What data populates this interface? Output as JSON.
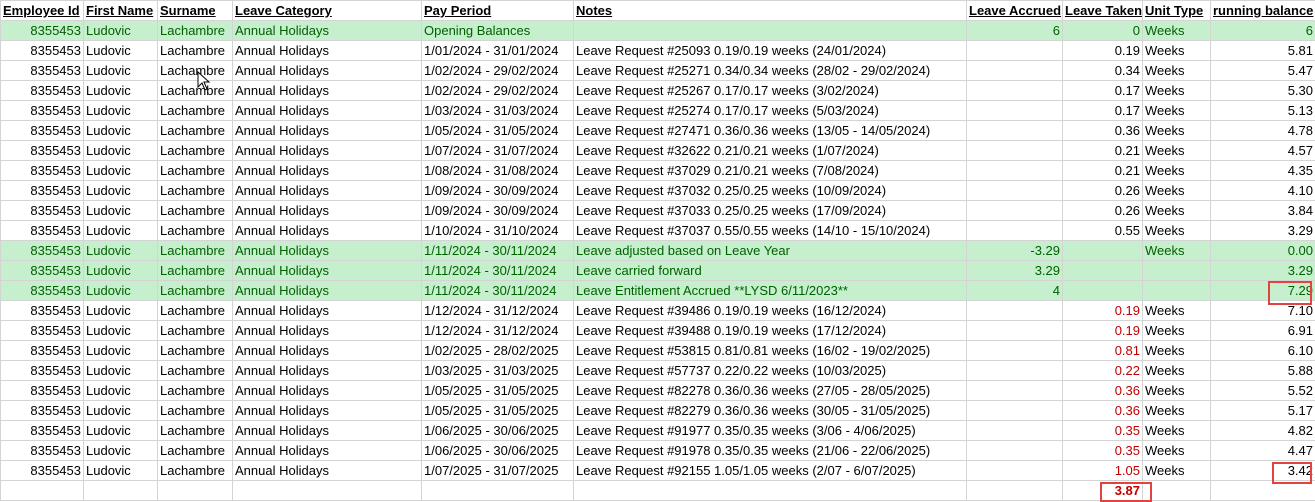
{
  "columns": [
    "Employee Id",
    "First Name",
    "Surname",
    "Leave Category",
    "Pay Period",
    "Notes",
    "Leave Accrued",
    "Leave Taken",
    "Unit Type",
    "running balance"
  ],
  "rows": [
    {
      "hl": true,
      "id": "8355453",
      "first": "Ludovic",
      "surname": "Lachambre",
      "category": "Annual Holidays",
      "period": "Opening Balances",
      "notes": "",
      "accrued": "6",
      "taken": "0",
      "unit": "Weeks",
      "balance": "6"
    },
    {
      "hl": false,
      "id": "8355453",
      "first": "Ludovic",
      "surname": "Lachambre",
      "category": "Annual Holidays",
      "period": "1/01/2024 - 31/01/2024",
      "notes": "Leave Request #25093 0.19/0.19 weeks (24/01/2024)",
      "accrued": "",
      "taken": "0.19",
      "unit": "Weeks",
      "balance": "5.81"
    },
    {
      "hl": false,
      "id": "8355453",
      "first": "Ludovic",
      "surname": "Lachambre",
      "category": "Annual Holidays",
      "period": "1/02/2024 - 29/02/2024",
      "notes": "Leave Request #25271 0.34/0.34 weeks (28/02 - 29/02/2024)",
      "accrued": "",
      "taken": "0.34",
      "unit": "Weeks",
      "balance": "5.47"
    },
    {
      "hl": false,
      "id": "8355453",
      "first": "Ludovic",
      "surname": "Lachambre",
      "category": "Annual Holidays",
      "period": "1/02/2024 - 29/02/2024",
      "notes": "Leave Request #25267 0.17/0.17 weeks (3/02/2024)",
      "accrued": "",
      "taken": "0.17",
      "unit": "Weeks",
      "balance": "5.30"
    },
    {
      "hl": false,
      "id": "8355453",
      "first": "Ludovic",
      "surname": "Lachambre",
      "category": "Annual Holidays",
      "period": "1/03/2024 - 31/03/2024",
      "notes": "Leave Request #25274 0.17/0.17 weeks (5/03/2024)",
      "accrued": "",
      "taken": "0.17",
      "unit": "Weeks",
      "balance": "5.13"
    },
    {
      "hl": false,
      "id": "8355453",
      "first": "Ludovic",
      "surname": "Lachambre",
      "category": "Annual Holidays",
      "period": "1/05/2024 - 31/05/2024",
      "notes": "Leave Request #27471 0.36/0.36 weeks (13/05 - 14/05/2024)",
      "accrued": "",
      "taken": "0.36",
      "unit": "Weeks",
      "balance": "4.78"
    },
    {
      "hl": false,
      "id": "8355453",
      "first": "Ludovic",
      "surname": "Lachambre",
      "category": "Annual Holidays",
      "period": "1/07/2024 - 31/07/2024",
      "notes": "Leave Request #32622 0.21/0.21 weeks (1/07/2024)",
      "accrued": "",
      "taken": "0.21",
      "unit": "Weeks",
      "balance": "4.57"
    },
    {
      "hl": false,
      "id": "8355453",
      "first": "Ludovic",
      "surname": "Lachambre",
      "category": "Annual Holidays",
      "period": "1/08/2024 - 31/08/2024",
      "notes": "Leave Request #37029 0.21/0.21 weeks (7/08/2024)",
      "accrued": "",
      "taken": "0.21",
      "unit": "Weeks",
      "balance": "4.35"
    },
    {
      "hl": false,
      "id": "8355453",
      "first": "Ludovic",
      "surname": "Lachambre",
      "category": "Annual Holidays",
      "period": "1/09/2024 - 30/09/2024",
      "notes": "Leave Request #37032 0.25/0.25 weeks (10/09/2024)",
      "accrued": "",
      "taken": "0.26",
      "unit": "Weeks",
      "balance": "4.10"
    },
    {
      "hl": false,
      "id": "8355453",
      "first": "Ludovic",
      "surname": "Lachambre",
      "category": "Annual Holidays",
      "period": "1/09/2024 - 30/09/2024",
      "notes": "Leave Request #37033 0.25/0.25 weeks (17/09/2024)",
      "accrued": "",
      "taken": "0.26",
      "unit": "Weeks",
      "balance": "3.84"
    },
    {
      "hl": false,
      "id": "8355453",
      "first": "Ludovic",
      "surname": "Lachambre",
      "category": "Annual Holidays",
      "period": "1/10/2024 - 31/10/2024",
      "notes": "Leave Request #37037 0.55/0.55 weeks (14/10 - 15/10/2024)",
      "accrued": "",
      "taken": "0.55",
      "unit": "Weeks",
      "balance": "3.29"
    },
    {
      "hl": true,
      "id": "8355453",
      "first": "Ludovic",
      "surname": "Lachambre",
      "category": "Annual Holidays",
      "period": "1/11/2024 - 30/11/2024",
      "notes": "Leave adjusted based on Leave Year",
      "accrued": "-3.29",
      "taken": "",
      "unit": "Weeks",
      "balance": "0.00"
    },
    {
      "hl": true,
      "id": "8355453",
      "first": "Ludovic",
      "surname": "Lachambre",
      "category": "Annual Holidays",
      "period": "1/11/2024 - 30/11/2024",
      "notes": "Leave carried forward",
      "accrued": "3.29",
      "taken": "",
      "unit": "",
      "balance": "3.29"
    },
    {
      "hl": true,
      "id": "8355453",
      "first": "Ludovic",
      "surname": "Lachambre",
      "category": "Annual Holidays",
      "period": "1/11/2024 - 30/11/2024",
      "notes": "Leave Entitlement Accrued **LYSD 6/11/2023**",
      "accrued": "4",
      "taken": "",
      "unit": "",
      "balance": "7.29"
    },
    {
      "hl": false,
      "id": "8355453",
      "first": "Ludovic",
      "surname": "Lachambre",
      "category": "Annual Holidays",
      "period": "1/12/2024 - 31/12/2024",
      "notes": "Leave Request #39486 0.19/0.19 weeks (16/12/2024)",
      "accrued": "",
      "taken": "0.19",
      "unit": "Weeks",
      "balance": "7.10",
      "red": true
    },
    {
      "hl": false,
      "id": "8355453",
      "first": "Ludovic",
      "surname": "Lachambre",
      "category": "Annual Holidays",
      "period": "1/12/2024 - 31/12/2024",
      "notes": "Leave Request #39488 0.19/0.19 weeks (17/12/2024)",
      "accrued": "",
      "taken": "0.19",
      "unit": "Weeks",
      "balance": "6.91",
      "red": true
    },
    {
      "hl": false,
      "id": "8355453",
      "first": "Ludovic",
      "surname": "Lachambre",
      "category": "Annual Holidays",
      "period": "1/02/2025 - 28/02/2025",
      "notes": "Leave Request #53815 0.81/0.81 weeks (16/02 - 19/02/2025)",
      "accrued": "",
      "taken": "0.81",
      "unit": "Weeks",
      "balance": "6.10",
      "red": true
    },
    {
      "hl": false,
      "id": "8355453",
      "first": "Ludovic",
      "surname": "Lachambre",
      "category": "Annual Holidays",
      "period": "1/03/2025 - 31/03/2025",
      "notes": "Leave Request #57737 0.22/0.22 weeks (10/03/2025)",
      "accrued": "",
      "taken": "0.22",
      "unit": "Weeks",
      "balance": "5.88",
      "red": true
    },
    {
      "hl": false,
      "id": "8355453",
      "first": "Ludovic",
      "surname": "Lachambre",
      "category": "Annual Holidays",
      "period": "1/05/2025 - 31/05/2025",
      "notes": "Leave Request #82278 0.36/0.36 weeks (27/05 - 28/05/2025)",
      "accrued": "",
      "taken": "0.36",
      "unit": "Weeks",
      "balance": "5.52",
      "red": true
    },
    {
      "hl": false,
      "id": "8355453",
      "first": "Ludovic",
      "surname": "Lachambre",
      "category": "Annual Holidays",
      "period": "1/05/2025 - 31/05/2025",
      "notes": "Leave Request #82279 0.36/0.36 weeks (30/05 - 31/05/2025)",
      "accrued": "",
      "taken": "0.36",
      "unit": "Weeks",
      "balance": "5.17",
      "red": true
    },
    {
      "hl": false,
      "id": "8355453",
      "first": "Ludovic",
      "surname": "Lachambre",
      "category": "Annual Holidays",
      "period": "1/06/2025 - 30/06/2025",
      "notes": "Leave Request #91977 0.35/0.35 weeks (3/06 - 4/06/2025)",
      "accrued": "",
      "taken": "0.35",
      "unit": "Weeks",
      "balance": "4.82",
      "red": true
    },
    {
      "hl": false,
      "id": "8355453",
      "first": "Ludovic",
      "surname": "Lachambre",
      "category": "Annual Holidays",
      "period": "1/06/2025 - 30/06/2025",
      "notes": "Leave Request #91978 0.35/0.35 weeks (21/06 - 22/06/2025)",
      "accrued": "",
      "taken": "0.35",
      "unit": "Weeks",
      "balance": "4.47",
      "red": true
    },
    {
      "hl": false,
      "id": "8355453",
      "first": "Ludovic",
      "surname": "Lachambre",
      "category": "Annual Holidays",
      "period": "1/07/2025 - 31/07/2025",
      "notes": "Leave Request #92155 1.05/1.05 weeks (2/07 - 6/07/2025)",
      "accrued": "",
      "taken": "1.05",
      "unit": "Weeks",
      "balance": "3.42",
      "red": true
    }
  ],
  "total_taken": "3.87",
  "colors": {
    "highlight_bg": "#c6efce",
    "highlight_text": "#006100",
    "red_text": "#c00000",
    "callout": "#e0443e"
  }
}
